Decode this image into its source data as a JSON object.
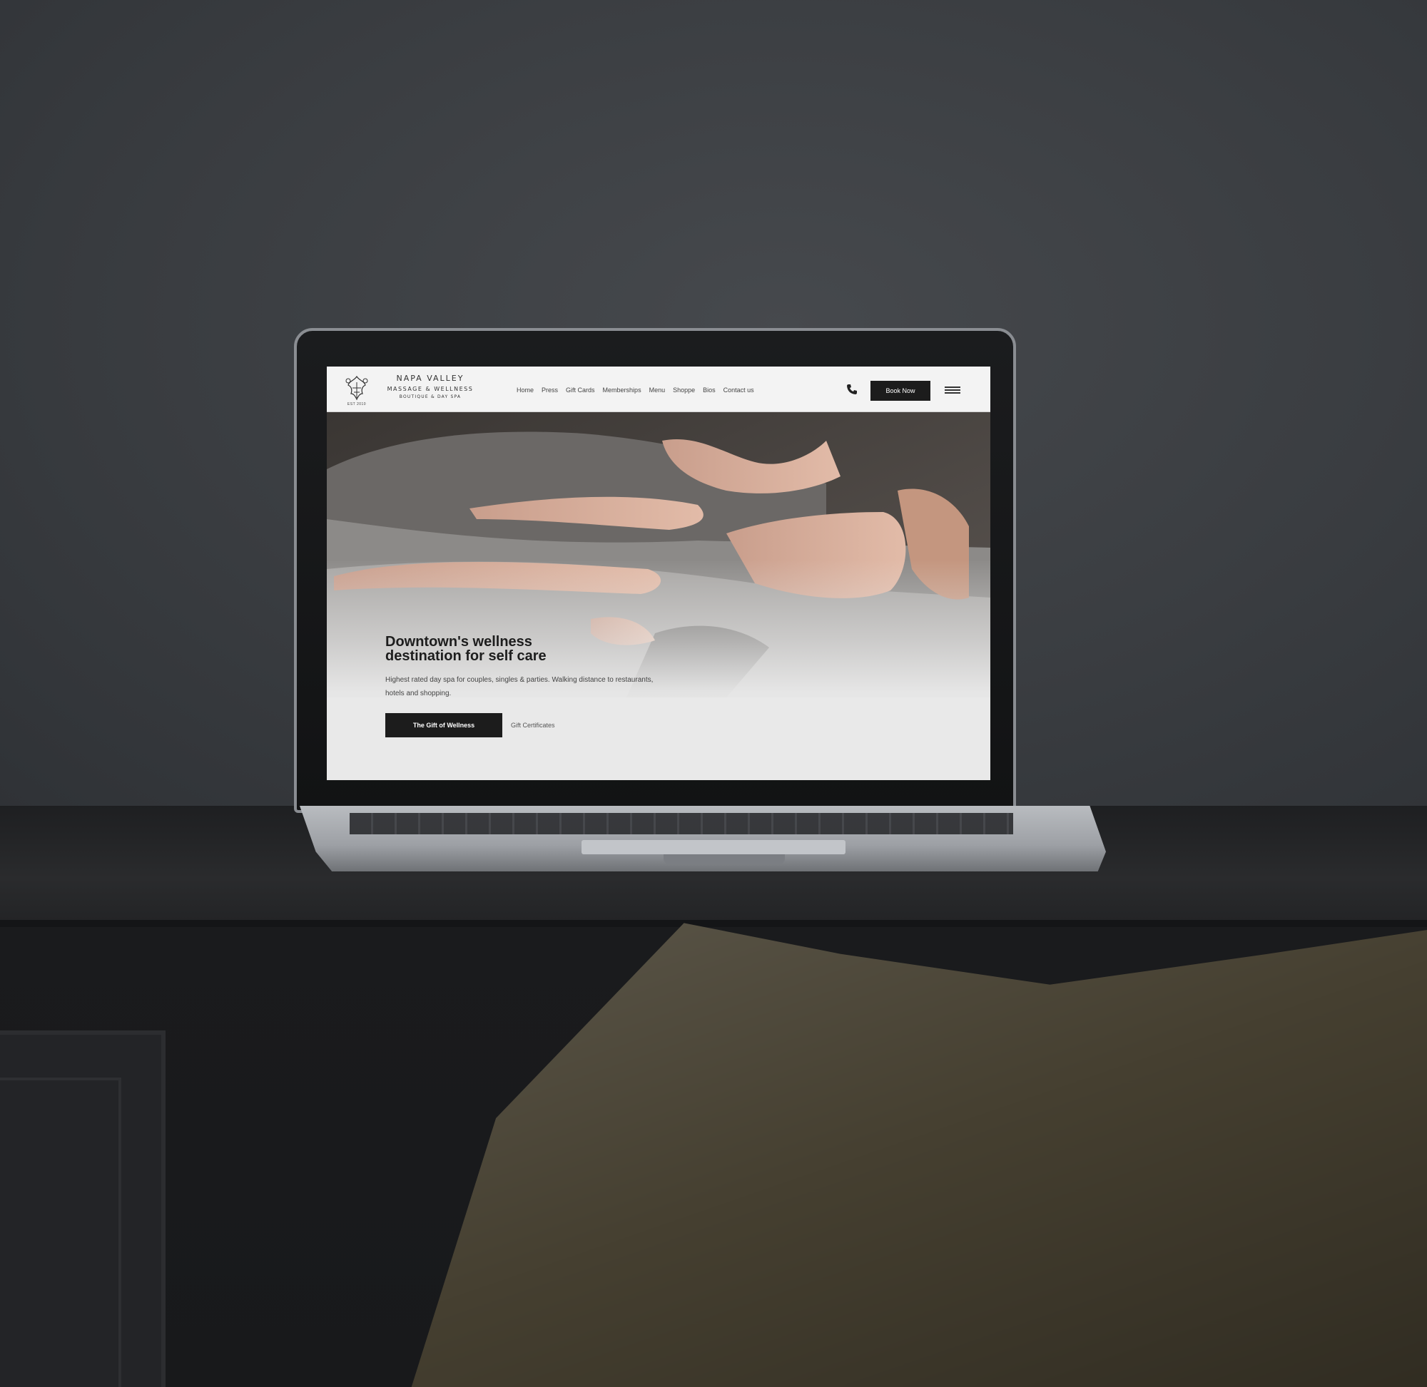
{
  "logo": {
    "line1": "NAPA VALLEY",
    "line2": "MASSAGE & WELLNESS",
    "line3": "BOUTIQUE & DAY SPA",
    "est": "EST 2010",
    "emblem_icon": "floral-crest-icon"
  },
  "nav": {
    "items": [
      {
        "label": "Home"
      },
      {
        "label": "Press"
      },
      {
        "label": "Gift Cards"
      },
      {
        "label": "Memberships"
      },
      {
        "label": "Menu"
      },
      {
        "label": "Shoppe"
      },
      {
        "label": "Bios"
      },
      {
        "label": "Contact us"
      }
    ],
    "phone_icon": "phone-icon",
    "book_label": "Book Now",
    "menu_icon": "hamburger-menu-icon"
  },
  "hero": {
    "title": "Downtown's wellness destination for self care",
    "description": "Highest rated day spa for couples, singles & parties. Walking distance to restaurants, hotels and shopping.",
    "primary_cta": "The Gift of Wellness",
    "secondary_cta": "Gift Certificates"
  },
  "colors": {
    "button_bg": "#1c1c1c",
    "header_bg": "#f3f3f3",
    "page_bg": "#e9e9e9"
  }
}
